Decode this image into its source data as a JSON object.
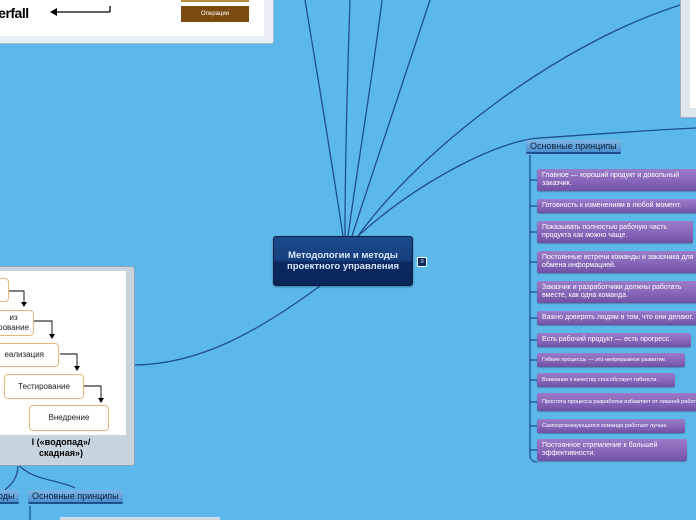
{
  "central": {
    "title": "Методологии и методы проектного управления"
  },
  "waterfall_image": {
    "title": "terfall",
    "operations_label": "Операции"
  },
  "waterfall_diagram": {
    "steps": [
      "",
      "из\nрование",
      "еализация",
      "Тестирование",
      "Внедрение"
    ],
    "caption": "l («водопад»/\nскадная»)"
  },
  "left_subtopics": {
    "methods": "оды",
    "principles": "Основные принципы"
  },
  "principles_group": {
    "label": "Основные принципы",
    "items": [
      "Главное — хороший продукт и довольный заказчик.",
      "Готовность к изменениям в любой момент.",
      "Показывать полностью рабочую часть продукта как можно чаще.",
      "Постоянные встречи команды и заказчика для обмена информацией.",
      "Заказчик и разработчики должны работать вместе, как одна команда.",
      "Важно доверять людям в том, что они делают.",
      "Есть рабочий продукт — есть прогресс.",
      "Гибкие процессы — это непрерывное развитие.",
      "Внимание к качеству способствует гибкости.",
      "Простота процесса разработки избавляет от лишней работы.",
      "Самоорганизующаяся команда работает лучше.",
      "Постоянное стремление к большей эффективности."
    ]
  },
  "colors": {
    "background": "#5cb8ea",
    "central_node": "#0b2a63",
    "principle_item": "#8666b8",
    "connector": "#1f4f8c"
  }
}
